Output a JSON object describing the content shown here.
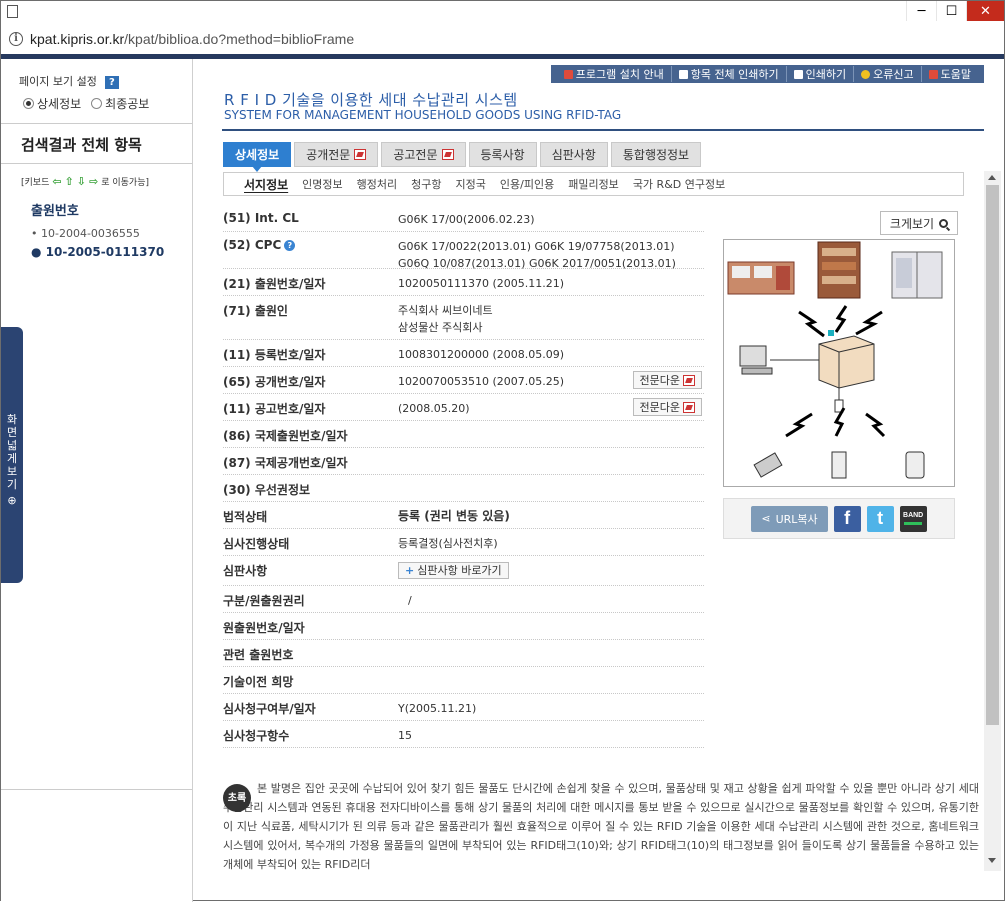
{
  "browser": {
    "url_host": "kpat.kipris.or.kr",
    "url_path": "/kpat/biblioa.do?method=biblioFrame",
    "buttons": {
      "minimize": "─",
      "maximize": "☐",
      "close": "✕"
    }
  },
  "left": {
    "view_setting": "페이지 보기 설정",
    "help": "?",
    "radio_detail": "상세정보",
    "radio_final": "최종공보",
    "results_title": "검색결과 전체 항목",
    "keyboard_prefix": "[키보드",
    "keyboard_suffix": "로 이동가능]",
    "appno_title": "출원번호",
    "items": [
      "10-2004-0036555",
      "10-2005-0111370"
    ],
    "side_tab": "화면넓게보기"
  },
  "toplinks": [
    "프로그램 설치 안내",
    "항목 전체 인쇄하기",
    "인쇄하기",
    "오류신고",
    "도움말"
  ],
  "doc": {
    "title_ko": "R F I D 기술을 이용한 세대 수납관리 시스템",
    "title_en": "SYSTEM FOR MANAGEMENT HOUSEHOLD GOODS USING RFID-TAG"
  },
  "tabs": [
    "상세정보",
    "공개전문",
    "공고전문",
    "등록사항",
    "심판사항",
    "통합행정정보"
  ],
  "subtabs": [
    "서지정보",
    "인명정보",
    "행정처리",
    "청구항",
    "지정국",
    "인용/피인용",
    "패밀리정보",
    "국가 R&D 연구정보"
  ],
  "fields": {
    "ipc_label": "(51) Int. CL",
    "ipc_value": "G06K 17/00(2006.02.23)",
    "cpc_label": "(52) CPC",
    "cpc_line1": "G06K 17/0022(2013.01) G06K 19/07758(2013.01)",
    "cpc_line2": "G06Q 10/087(2013.01) G06K 2017/0051(2013.01)",
    "app_label": "(21) 출원번호/일자",
    "app_value": "1020050111370 (2005.11.21)",
    "applicant_label": "(71) 출원인",
    "applicant_1": "주식회사 씨브이네트",
    "applicant_2": "삼성물산 주식회사",
    "reg_label": "(11) 등록번호/일자",
    "reg_value": "1008301200000 (2008.05.09)",
    "pub_label": "(65) 공개번호/일자",
    "pub_value": "1020070053510 (2007.05.25)",
    "ann_label": "(11) 공고번호/일자",
    "ann_value": "(2008.05.20)",
    "intl_app_label": "(86) 국제출원번호/일자",
    "intl_pub_label": "(87) 국제공개번호/일자",
    "priority_label": "(30) 우선권정보",
    "legal_label": "법적상태",
    "legal_value": "등록 (권리 변동 있음)",
    "exam_label": "심사진행상태",
    "exam_value": "등록결정(심사전치후)",
    "trial_label": "심판사항",
    "trial_btn": "심판사항 바로가기",
    "division_label": "구분/원출원권리",
    "division_value": "/",
    "orig_label": "원출원번호/일자",
    "related_label": "관련 출원번호",
    "transfer_label": "기술이전 희망",
    "examreq_label": "심사청구여부/일자",
    "examreq_value": "Y(2005.11.21)",
    "claims_label": "심사청구항수",
    "claims_value": "15",
    "download": "전문다운"
  },
  "media": {
    "zoom": "크게보기",
    "url_copy": "URL복사",
    "band": "BAND"
  },
  "abstract": {
    "badge": "초록",
    "text": "본 발명은 집안 곳곳에 수납되어 있어 찾기 힘든 물품도 단시간에 손쉽게 찾을 수 있으며, 물품상태 및 재고 상황을 쉽게 파악할 수 있을 뿐만 아니라 상기 세대수납관리 시스템과 연동된 휴대용 전자디바이스를 통해 상기 물품의 처리에 대한 메시지를 통보 받을 수 있으므로 실시간으로 물품정보를 확인할 수 있으며, 유통기한이 지난 식료품, 세탁시기가 된 의류 등과 같은 물품관리가 훨씬 효율적으로 이루어 질 수 있는 RFID 기술을 이용한 세대 수납관리 시스템에 관한 것으로, 홈네트워크 시스템에 있어서, 복수개의 가정용 물품들의 일면에 부착되어 있는 RFID태그(10)와; 상기 RFID태그(10)의 태그정보를 읽어 들이도록 상기 물품들을 수용하고 있는 개체에 부착되어 있는 RFID리더"
  }
}
